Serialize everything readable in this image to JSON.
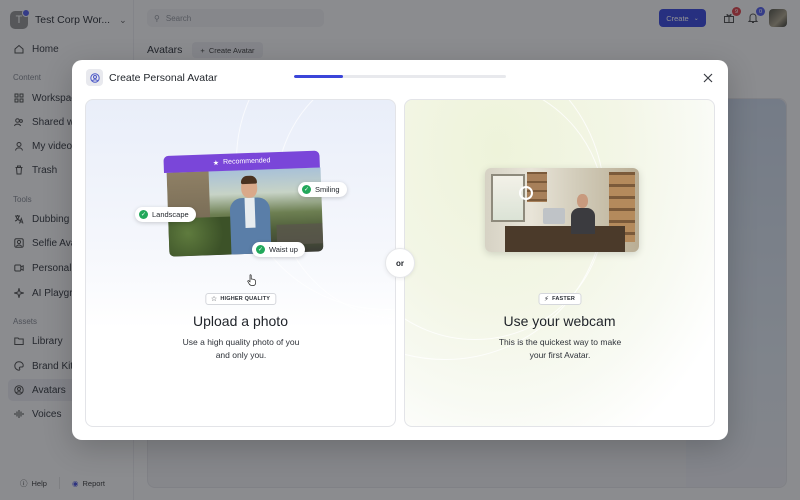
{
  "sidebar": {
    "workspace_initial": "T",
    "workspace_name": "Test Corp Wor...",
    "home": "Home",
    "section_content": "Content",
    "workspace": "Workspace",
    "shared": "Shared with",
    "my_videos": "My videos",
    "trash": "Trash",
    "section_tools": "Tools",
    "dubbing": "Dubbing",
    "selfie": "Selfie Avata",
    "personalize": "Personaliza",
    "playground": "AI Playgrou",
    "section_assets": "Assets",
    "library": "Library",
    "brand_kits": "Brand Kits",
    "avatars": "Avatars",
    "voices": "Voices",
    "help": "Help",
    "report": "Report"
  },
  "topbar": {
    "search_placeholder": "Search",
    "create_label": "Create",
    "gift_badge": "9",
    "bell_badge": "0"
  },
  "page": {
    "title": "Avatars",
    "create_avatar": "Create Avatar"
  },
  "modal": {
    "title": "Create Personal Avatar",
    "progress_fraction": 0.23,
    "or_label": "or",
    "upload": {
      "recommended": "Recommended",
      "tag_landscape": "Landscape",
      "tag_smiling": "Smiling",
      "tag_waist": "Waist up",
      "chip": "HIGHER QUALITY",
      "title": "Upload a photo",
      "desc": "Use a high quality photo of you and only you."
    },
    "webcam": {
      "chip": "FASTER",
      "title": "Use your webcam",
      "desc": "This is the quickest way to make your first Avatar."
    }
  },
  "colors": {
    "accent": "#2f3ed8",
    "recommended": "#7a46d9",
    "check": "#22a85b",
    "gift_badge": "#d9363e",
    "bell_badge": "#4b57e8"
  }
}
